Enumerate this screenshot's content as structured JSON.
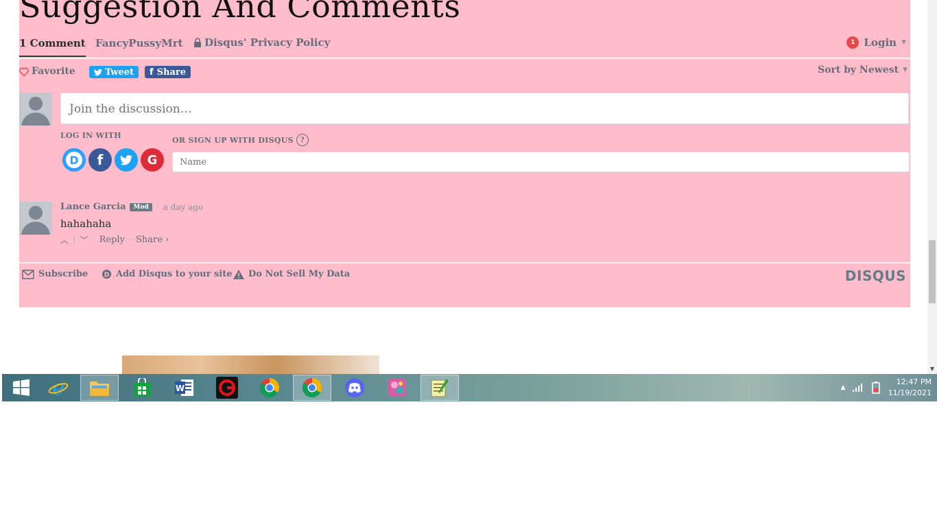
{
  "page": {
    "title": "Suggestion And Comments"
  },
  "nav": {
    "comments_tab": "1 Comment",
    "community_tab": "FancyPussyMrt",
    "privacy_link": "Disqus' Privacy Policy",
    "login_label": "Login",
    "notification_count": "1"
  },
  "actions": {
    "favorite_label": "Favorite",
    "tweet_label": "Tweet",
    "share_label": "Share",
    "sort_label": "Sort by Newest"
  },
  "compose": {
    "placeholder": "Join the discussion…",
    "login_with_label": "LOG IN WITH",
    "signup_label": "OR SIGN UP WITH DISQUS",
    "help_label": "?",
    "name_placeholder": "Name",
    "providers": [
      "D",
      "f",
      "t",
      "G"
    ]
  },
  "comment": {
    "author": "Lance Garcia",
    "badge": "Mod",
    "separator": "·",
    "time": "a day ago",
    "text": "hahahaha",
    "reply_label": "Reply",
    "share_label": "Share ›"
  },
  "footer": {
    "subscribe_label": "Subscribe",
    "add_disqus_label": "Add Disqus to your site",
    "do_not_sell_label": "Do Not Sell My Data",
    "logo_text": "DISQUS"
  },
  "taskbar": {
    "apps": [
      "start-button",
      "internet-explorer",
      "file-explorer",
      "store",
      "word",
      "garena",
      "chrome",
      "chrome-active",
      "discord",
      "paint-app",
      "notepad-app"
    ],
    "time": "12:47 PM",
    "date": "11/19/2021"
  },
  "colors": {
    "page_accent": "#ffbccb",
    "tweet": "#1da1f2",
    "facebook": "#3b5998",
    "google": "#dd4b39",
    "notification": "#e14b4b"
  }
}
